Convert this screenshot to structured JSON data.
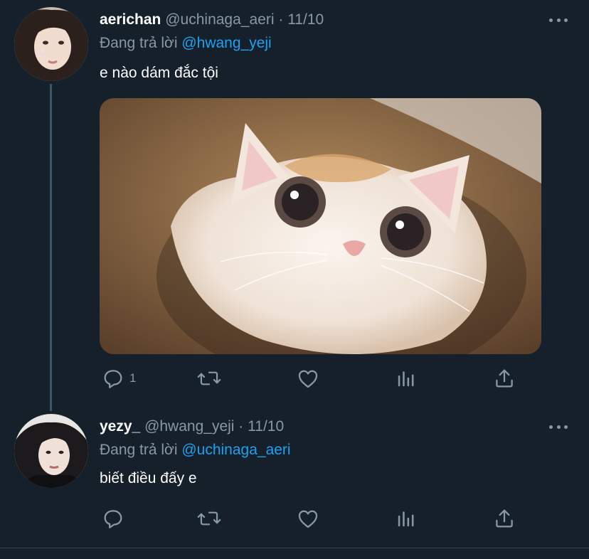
{
  "tweets": [
    {
      "name": "aerichan",
      "handle": "@uchinaga_aeri",
      "separator": "·",
      "date": "11/10",
      "reply_prefix": "Đang trả lời",
      "reply_to": "@hwang_yeji",
      "text": "e nào dám đắc tội",
      "reply_count": "1",
      "has_media": true
    },
    {
      "name": "yezy_",
      "handle": "@hwang_yeji",
      "separator": "·",
      "date": "11/10",
      "reply_prefix": "Đang trả lời",
      "reply_to": "@uchinaga_aeri",
      "text": "biết điều đấy e",
      "reply_count": ""
    }
  ],
  "icons": {
    "reply": "speech-bubble-icon",
    "retweet": "retweet-arrows-icon",
    "like": "heart-outline-icon",
    "stats": "bar-chart-icon",
    "share": "upload-share-icon",
    "more": "three-dots-icon"
  },
  "colors": {
    "background": "#15202b",
    "secondary_text": "#8899a6",
    "mention": "#1da1f2",
    "divider": "#38444d"
  }
}
